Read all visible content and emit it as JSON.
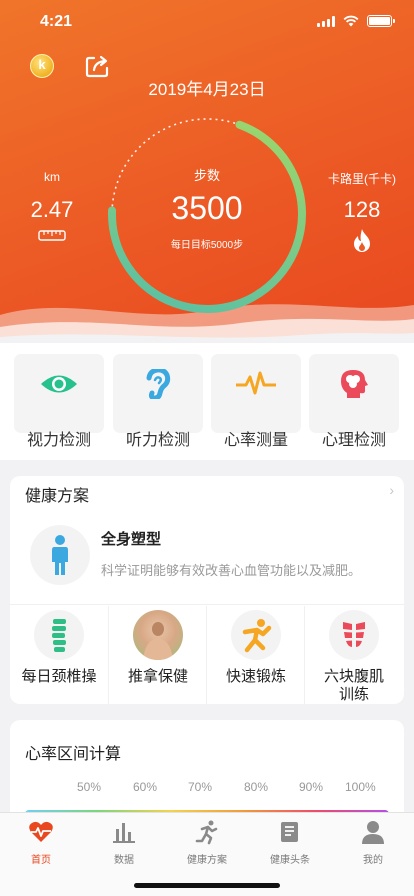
{
  "status_bar": {
    "time": "4:21",
    "icons": [
      "signal-icon",
      "wifi-icon",
      "battery-icon"
    ]
  },
  "header": {
    "coin_letter": "k",
    "date": "2019年4月23日",
    "steps": {
      "label": "步数",
      "value": "3500",
      "goal": "每日目标5000步",
      "progress": 0.7
    },
    "distance": {
      "unit": "km",
      "value": "2.47",
      "icon": "ruler-icon"
    },
    "calories": {
      "unit": "卡路里(千卡)",
      "value": "128",
      "icon": "flame-icon"
    },
    "colors": {
      "background": "#ec5a25",
      "ring_start": "#66c39c",
      "ring_end": "#8fd17a"
    }
  },
  "checks": [
    {
      "label": "视力检测",
      "icon": "eye-icon",
      "color": "#27c18d"
    },
    {
      "label": "听力检测",
      "icon": "ear-icon",
      "color": "#3ca8e0"
    },
    {
      "label": "心率测量",
      "icon": "heartbeat-icon",
      "color": "#f5a623"
    },
    {
      "label": "心理检测",
      "icon": "brain-head-icon",
      "color": "#ea4a5a"
    }
  ],
  "plan": {
    "title": "健康方案",
    "feature": {
      "title": "全身塑型",
      "desc": "科学证明能够有效改善心血管功能以及减肥。",
      "icon": "body-figure-icon"
    },
    "items": [
      {
        "label": "每日颈椎操",
        "icon": "spine-icon"
      },
      {
        "label": "推拿保健",
        "icon": "massage-photo"
      },
      {
        "label": "快速锻炼",
        "icon": "exercise-icon"
      },
      {
        "label": "六块腹肌训练",
        "label_line1": "六块腹肌",
        "label_line2": "训练",
        "icon": "abs-icon"
      }
    ]
  },
  "heart_rate": {
    "title": "心率区间计算",
    "scale": [
      "50%",
      "60%",
      "70%",
      "80%",
      "90%",
      "100%"
    ]
  },
  "tabbar": {
    "active": 0,
    "tabs": [
      {
        "label": "首页",
        "icon": "heart-pulse-icon"
      },
      {
        "label": "数据",
        "icon": "bar-chart-icon"
      },
      {
        "label": "健康方案",
        "icon": "runner-icon"
      },
      {
        "label": "健康头条",
        "icon": "news-icon"
      },
      {
        "label": "我的",
        "icon": "profile-icon"
      }
    ]
  }
}
